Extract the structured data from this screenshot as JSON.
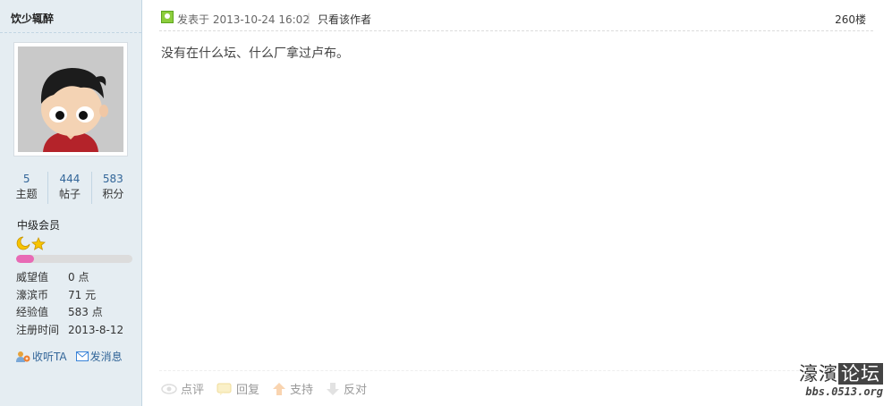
{
  "user": {
    "name": "饮少辄醉",
    "stats": [
      {
        "value": "5",
        "label": "主题"
      },
      {
        "value": "444",
        "label": "帖子"
      },
      {
        "value": "583",
        "label": "积分"
      }
    ],
    "rank": "中级会员",
    "progress_fraction": 0.15,
    "info": [
      {
        "key": "威望值",
        "value": "0 点"
      },
      {
        "key": "濠滨币",
        "value": "71 元"
      },
      {
        "key": "经验值",
        "value": "583 点"
      },
      {
        "key": "注册时间",
        "value": "2013-8-12"
      }
    ],
    "follow_label": "收听TA",
    "message_label": "发消息"
  },
  "post": {
    "posted_at": "发表于 2013-10-24 16:02",
    "separator": "|",
    "author_only": "只看该作者",
    "floor": "260楼",
    "body": "没有在什么坛、什么厂拿过卢布。"
  },
  "footer": {
    "rate": "点评",
    "reply": "回复",
    "support": "支持",
    "oppose": "反对"
  },
  "watermark": {
    "left": "濠濱",
    "right": "论坛",
    "url": "bbs.0513.org"
  },
  "colors": {
    "sidebar_bg": "#e5edf2",
    "link": "#336699",
    "progress": "#e86ab5"
  }
}
